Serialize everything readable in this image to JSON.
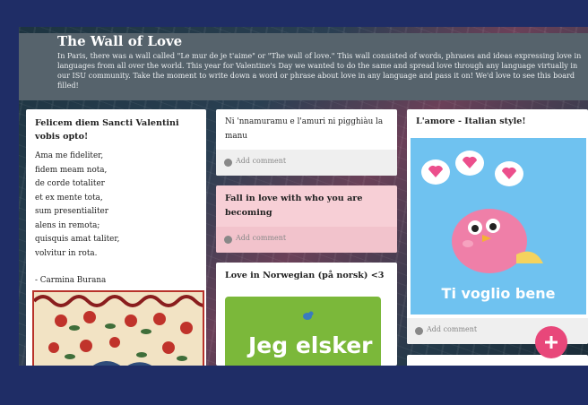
{
  "header": {
    "title": "The Wall of Love",
    "description": "In Paris, there was a wall called \"Le mur de je t'aime\" or \"The wall of love.\" This wall consisted of words, phrases and ideas expressing love in languages from all over the world. This year for Valentine's Day we wanted to do the same and spread love through any language virtually in our ISU community. Take the moment to write down a word or phrase about love in any language and pass it on! We'd love to see this board filled!"
  },
  "cards": {
    "latin": {
      "title": "Felicem diem Sancti Valentini vobis opto!",
      "lines": [
        "Ama me fideliter,",
        "fidem meam nota,",
        "de corde totaliter",
        "et ex mente tota,",
        "sum presentialiter",
        "alens in remota;",
        "quisquis amat taliter,",
        "volvitur in rota."
      ],
      "signature": "- Carmina Burana"
    },
    "sicilian": {
      "body": "Ni 'nnamuramu e l'amuri ni pigghiàu la manu",
      "comment": "Add comment"
    },
    "fall": {
      "title": "Fall in love with who you are becoming",
      "comment": "Add comment"
    },
    "norwegian": {
      "title": "Love in Norwegian (på norsk) <3",
      "image_text": "Jeg elsker"
    },
    "italian": {
      "title": "L'amore - Italian style!",
      "image_text": "Ti voglio bene",
      "comment": "Add comment"
    }
  },
  "colors": {
    "page_bg": "#1f2d66",
    "header_bg": "#56636c",
    "pink_card": "#f7cfd6",
    "fab": "#e8477a"
  }
}
